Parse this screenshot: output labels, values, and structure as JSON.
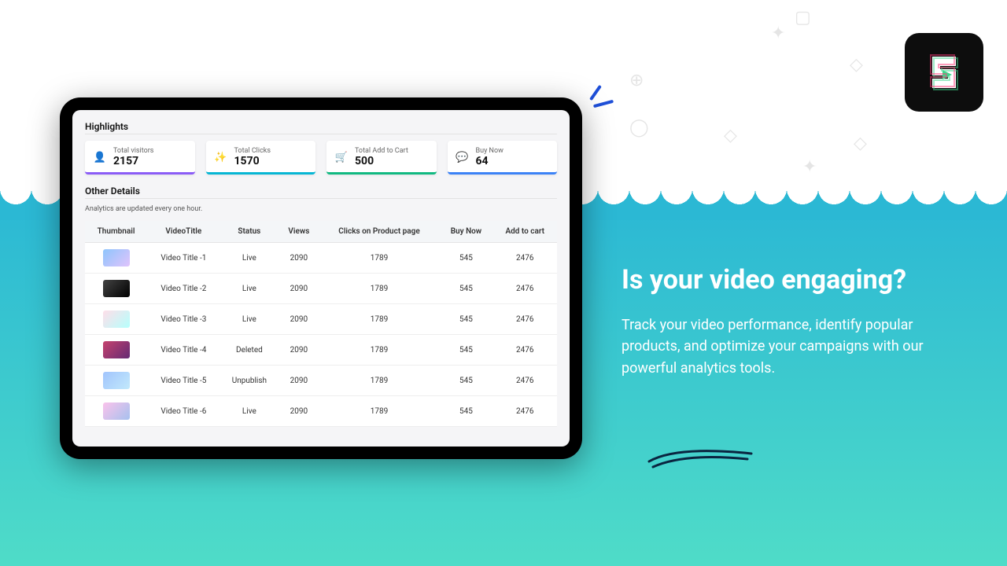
{
  "dashboard": {
    "highlights_title": "Highlights",
    "other_title": "Other Details",
    "update_note": "Analytics are updated every one hour.",
    "cards": [
      {
        "label": "Total visitors",
        "value": "2157",
        "icon": "👤"
      },
      {
        "label": "Total Clicks",
        "value": "1570",
        "icon": "✨"
      },
      {
        "label": "Total Add to Cart",
        "value": "500",
        "icon": "🛒"
      },
      {
        "label": "Buy Now",
        "value": "64",
        "icon": "💬"
      }
    ],
    "columns": [
      "Thumbnail",
      "VideoTitle",
      "Status",
      "Views",
      "Clicks on Product page",
      "Buy Now",
      "Add to cart"
    ],
    "rows": [
      {
        "title": "Video Title -1",
        "status": "Live",
        "views": "2090",
        "clicks": "1789",
        "buy": "545",
        "cart": "2476"
      },
      {
        "title": "Video Title -2",
        "status": "Live",
        "views": "2090",
        "clicks": "1789",
        "buy": "545",
        "cart": "2476"
      },
      {
        "title": "Video Title -3",
        "status": "Live",
        "views": "2090",
        "clicks": "1789",
        "buy": "545",
        "cart": "2476"
      },
      {
        "title": "Video Title -4",
        "status": "Deleted",
        "views": "2090",
        "clicks": "1789",
        "buy": "545",
        "cart": "2476"
      },
      {
        "title": "Video Title -5",
        "status": "Unpublish",
        "views": "2090",
        "clicks": "1789",
        "buy": "545",
        "cart": "2476"
      },
      {
        "title": "Video Title -6",
        "status": "Live",
        "views": "2090",
        "clicks": "1789",
        "buy": "545",
        "cart": "2476"
      }
    ]
  },
  "promo": {
    "heading": "Is your video engaging?",
    "body": "Track your video performance, identify popular products, and optimize your campaigns with our powerful analytics tools."
  }
}
